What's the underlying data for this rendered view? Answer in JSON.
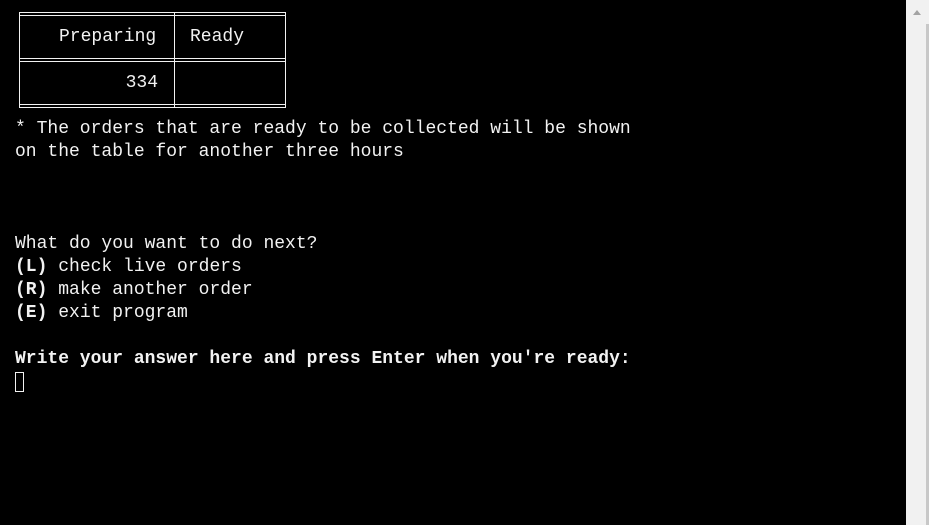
{
  "table": {
    "headers": [
      "Preparing",
      "Ready"
    ],
    "rows": [
      {
        "preparing": "334",
        "ready": ""
      }
    ]
  },
  "note": {
    "line1": "* The orders that are ready to be collected will be shown",
    "line2": "on the table for another three hours"
  },
  "menu": {
    "question": "What do you want to do next?",
    "options": [
      {
        "key": "(L)",
        "label": "check live orders"
      },
      {
        "key": "(R)",
        "label": "make another order"
      },
      {
        "key": "(E)",
        "label": "exit program"
      }
    ]
  },
  "prompt": {
    "text": "Write your answer here and press Enter when you're ready:"
  }
}
